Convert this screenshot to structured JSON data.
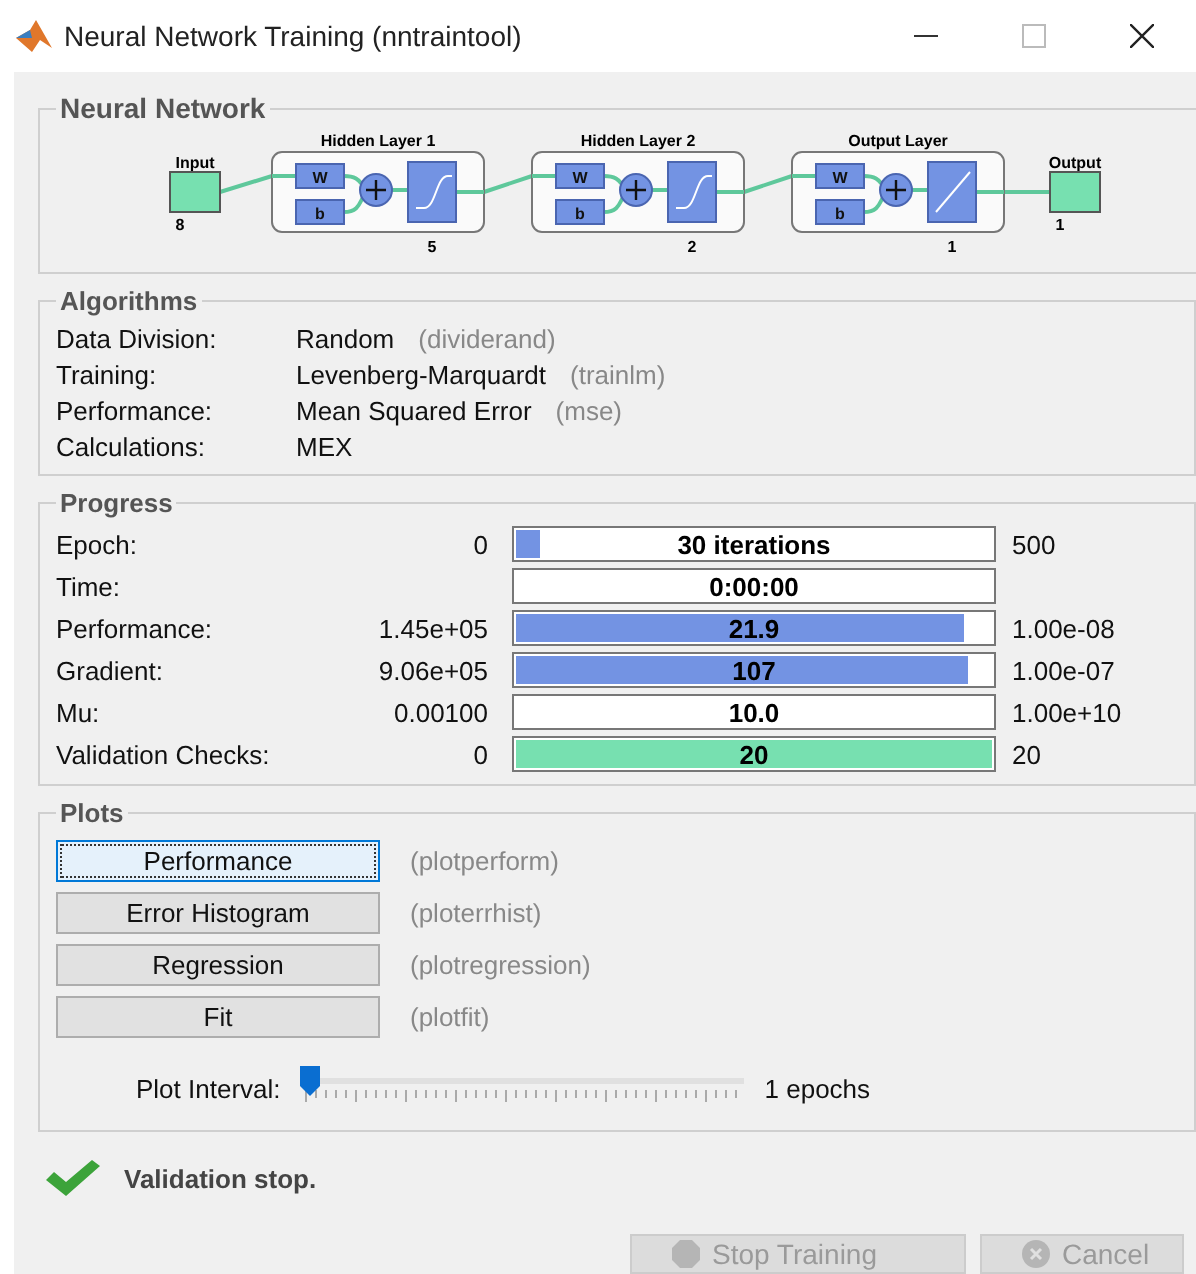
{
  "window": {
    "title": "Neural Network Training (nntraintool)"
  },
  "network": {
    "title": "Neural Network",
    "input": {
      "label": "Input",
      "size": "8"
    },
    "layers": [
      {
        "title": "Hidden Layer 1",
        "weight": "W",
        "bias": "b",
        "kind": "sigmoid",
        "size": "5"
      },
      {
        "title": "Hidden Layer 2",
        "weight": "W",
        "bias": "b",
        "kind": "sigmoid",
        "size": "2"
      },
      {
        "title": "Output Layer",
        "weight": "W",
        "bias": "b",
        "kind": "linear",
        "size": "1"
      }
    ],
    "output": {
      "label": "Output",
      "size": "1"
    }
  },
  "algorithms": {
    "title": "Algorithms",
    "rows": [
      {
        "label": "Data Division:",
        "value": "Random",
        "function": "(dividerand)"
      },
      {
        "label": "Training:",
        "value": "Levenberg-Marquardt",
        "function": "(trainlm)"
      },
      {
        "label": "Performance:",
        "value": "Mean Squared Error",
        "function": "(mse)"
      },
      {
        "label": "Calculations:",
        "value": "MEX"
      }
    ]
  },
  "progress": {
    "title": "Progress",
    "rows": [
      {
        "label": "Epoch:",
        "min": "0",
        "value": "30 iterations",
        "max": "500",
        "level": 0.06,
        "kind": "measure"
      },
      {
        "label": "Time:",
        "value": "0:00:00",
        "level": 0,
        "kind": "measure"
      },
      {
        "label": "Performance:",
        "min": "1.45e+05",
        "value": "21.9",
        "max": "1.00e-08",
        "level": 0.94,
        "kind": "measure"
      },
      {
        "label": "Gradient:",
        "min": "9.06e+05",
        "value": "107",
        "max": "1.00e-07",
        "level": 0.95,
        "kind": "measure"
      },
      {
        "label": "Mu:",
        "min": "0.00100",
        "value": "10.0",
        "max": "1.00e+10",
        "level": 0,
        "kind": "measure"
      },
      {
        "label": "Validation Checks:",
        "min": "0",
        "value": "20",
        "max": "20",
        "level": 1,
        "kind": "check"
      }
    ]
  },
  "plots": {
    "title": "Plots",
    "buttons": [
      {
        "label": "Performance",
        "function": "(plotperform)",
        "focused": true
      },
      {
        "label": "Error Histogram",
        "function": "(ploterrhist)",
        "focused": false
      },
      {
        "label": "Regression",
        "function": "(plotregression)",
        "focused": false
      },
      {
        "label": "Fit",
        "function": "(plotfit)",
        "focused": false
      }
    ],
    "interval": {
      "label": "Plot Interval:",
      "level": 0,
      "reading": "1 epochs"
    }
  },
  "status": {
    "message": "Validation stop."
  },
  "buttons": [
    {
      "label": "Stop Training",
      "kind": "stop",
      "disabled": true
    },
    {
      "label": "Cancel",
      "kind": "cancel",
      "disabled": true
    }
  ]
}
